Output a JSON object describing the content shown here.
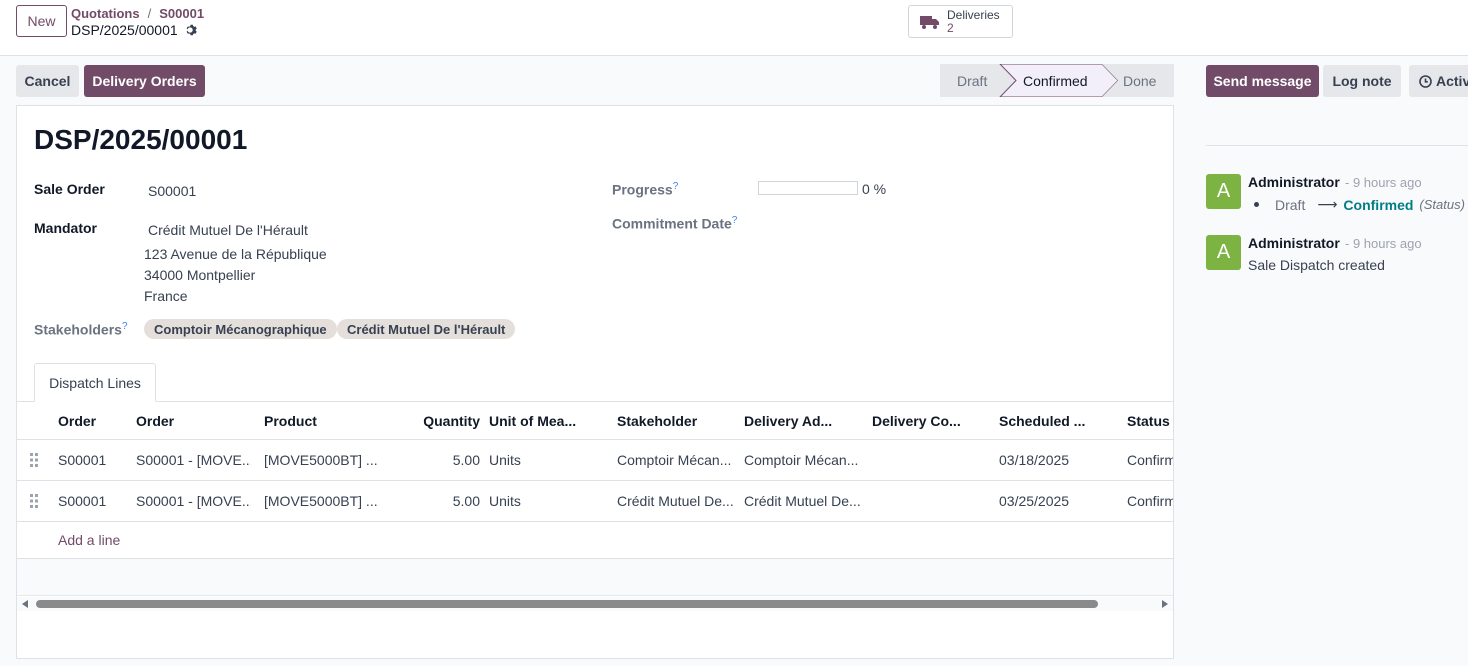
{
  "header": {
    "new_label": "New",
    "breadcrumb": [
      "Quotations",
      "S00001"
    ],
    "breadcrumb_sep": "/",
    "record_name": "DSP/2025/00001",
    "smart_button": {
      "label": "Deliveries",
      "count": "2",
      "icon": "truck-icon"
    }
  },
  "actions": {
    "cancel": "Cancel",
    "delivery_orders": "Delivery Orders"
  },
  "statusbar": {
    "stages": [
      "Draft",
      "Confirmed",
      "Done"
    ],
    "active": "Confirmed"
  },
  "chatter_actions": {
    "send_message": "Send message",
    "log_note": "Log note",
    "activities": "Activi"
  },
  "form": {
    "title": "DSP/2025/00001",
    "sale_order_label": "Sale Order",
    "sale_order_value": "S00001",
    "mandator_label": "Mandator",
    "mandator_name": "Crédit Mutuel De l'Hérault",
    "mandator_address": [
      "123 Avenue de la République",
      "34000 Montpellier",
      "France"
    ],
    "stakeholders_label": "Stakeholders",
    "stakeholders": [
      "Comptoir Mécanographique",
      "Crédit Mutuel De l'Hérault"
    ],
    "progress_label": "Progress",
    "progress_value": 0,
    "progress_text": "0 %",
    "commitment_label": "Commitment Date",
    "help_mark": "?"
  },
  "tabs": [
    "Dispatch Lines"
  ],
  "grid": {
    "columns": [
      "Order",
      "Order",
      "Product",
      "Quantity",
      "Unit of Mea...",
      "Stakeholder",
      "Delivery Ad...",
      "Delivery Co...",
      "Scheduled ...",
      "Status"
    ],
    "rows": [
      [
        "S00001",
        "S00001 - [MOVE...",
        "[MOVE5000BT] ...",
        "5.00",
        "Units",
        "Comptoir Mécan...",
        "Comptoir Mécan...",
        "",
        "03/18/2025",
        "Confirm"
      ],
      [
        "S00001",
        "S00001 - [MOVE...",
        "[MOVE5000BT] ...",
        "5.00",
        "Units",
        "Crédit Mutuel De...",
        "Crédit Mutuel De...",
        "",
        "03/25/2025",
        "Confirm"
      ]
    ],
    "add_line": "Add a line"
  },
  "chatter": {
    "messages": [
      {
        "avatar": "A",
        "author": "Administrator",
        "time": "- 9 hours ago",
        "from": "Draft",
        "arrow": "⟶",
        "to": "Confirmed",
        "field": "(Status)"
      },
      {
        "avatar": "A",
        "author": "Administrator",
        "time": "- 9 hours ago",
        "body": "Sale Dispatch created"
      }
    ]
  },
  "colors": {
    "brand": "#714b67",
    "avatar": "#7cb342",
    "link": "#017e84"
  }
}
